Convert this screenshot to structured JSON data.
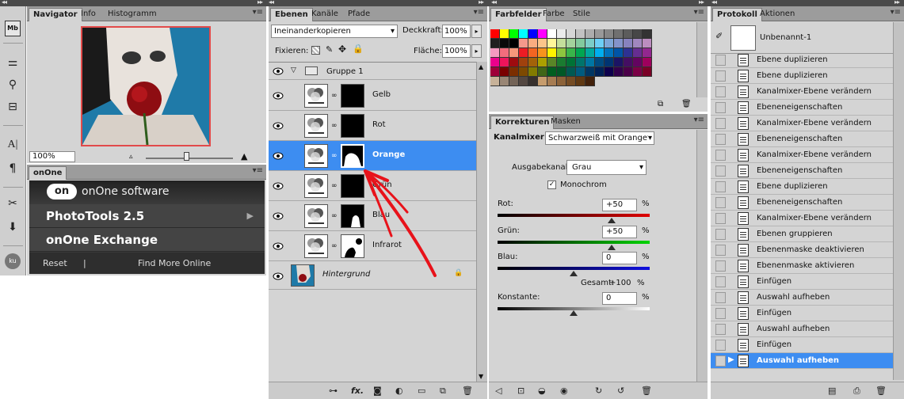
{
  "navigator_panel": {
    "tabs": [
      "Navigator",
      "Info",
      "Histogramm"
    ],
    "zoom": "100%"
  },
  "onone_panel": {
    "tab": "onOne",
    "brand_logo": "on",
    "brand_text": "onOne software",
    "items": [
      "PhotoTools 2.5",
      "onOne Exchange"
    ],
    "footer_reset": "Reset",
    "footer_separator": "|",
    "footer_find": "Find More Online"
  },
  "left_tools": {
    "mb_label": "Mb",
    "ku_label": "ku"
  },
  "layers_panel": {
    "tabs": [
      "Ebenen",
      "Kanäle",
      "Pfade"
    ],
    "blend_mode": "Ineinanderkopieren",
    "opacity_label": "Deckkraft:",
    "opacity_value": "100%",
    "lock_label": "Fixieren:",
    "fill_label": "Fläche:",
    "fill_value": "100%",
    "group_name": "Gruppe 1",
    "layers": [
      {
        "name": "Gelb"
      },
      {
        "name": "Rot"
      },
      {
        "name": "Orange"
      },
      {
        "name": "Grün"
      },
      {
        "name": "Blau"
      },
      {
        "name": "Infrarot"
      }
    ],
    "background_name": "Hintergrund"
  },
  "swatches_panel": {
    "tabs": [
      "Farbfelder",
      "Farbe",
      "Stile"
    ],
    "colors": [
      "#ff0000",
      "#ffff00",
      "#00ff00",
      "#00ffff",
      "#0000ff",
      "#ff00ff",
      "#ffffff",
      "#ebebeb",
      "#d6d6d6",
      "#c2c2c2",
      "#adadad",
      "#999999",
      "#858585",
      "#707070",
      "#5c5c5c",
      "#474747",
      "#333333",
      "#1f1f1f",
      "#0a0a0a",
      "#000000",
      "#f5998c",
      "#f9ad81",
      "#fdc68a",
      "#fff79a",
      "#c4df9b",
      "#a3d39c",
      "#82ca9d",
      "#7bcdc8",
      "#6ecff6",
      "#7ea7d8",
      "#8493ca",
      "#8882be",
      "#a187be",
      "#bc8dbf",
      "#f49ac1",
      "#f26d7d",
      "#f7977a",
      "#ed1c24",
      "#f26522",
      "#f7941d",
      "#fff200",
      "#8dc63f",
      "#39b54a",
      "#00a651",
      "#00a99d",
      "#00aeef",
      "#0072bc",
      "#0054a6",
      "#2e3192",
      "#662d91",
      "#92278f",
      "#ec008c",
      "#ed145b",
      "#9e0b0f",
      "#a0410d",
      "#a36209",
      "#aba000",
      "#598527",
      "#1a7b30",
      "#007236",
      "#00746b",
      "#0076a3",
      "#004b80",
      "#003471",
      "#1b1464",
      "#440e62",
      "#630460",
      "#9e005d",
      "#9e0039",
      "#790000",
      "#7b2e00",
      "#7d4900",
      "#827b00",
      "#406618",
      "#005e20",
      "#005826",
      "#005952",
      "#005b7f",
      "#003663",
      "#002157",
      "#0d004c",
      "#32004b",
      "#4b0049",
      "#7b0046",
      "#7a0026",
      "#c7b299",
      "#998675",
      "#736357",
      "#534741",
      "#37302d",
      "#c69c6d",
      "#a67c52",
      "#8c6239",
      "#754c24",
      "#603913",
      "#42210b"
    ]
  },
  "adjustments_panel": {
    "tabs": [
      "Korrekturen",
      "Masken"
    ],
    "title": "Kanalmixer",
    "preset": "Schwarzweiß mit Orangef",
    "output_label": "Ausgabekanal:",
    "output_value": "Grau",
    "monochrome_label": "Monochrom",
    "sliders": [
      {
        "label": "Rot:",
        "value": "+50",
        "unit": "%",
        "level": 0.75
      },
      {
        "label": "Grün:",
        "value": "+50",
        "unit": "%",
        "level": 0.75
      },
      {
        "label": "Blau:",
        "value": "0",
        "unit": "%",
        "level": 0.5
      }
    ],
    "total_label": "Gesamt:",
    "total_value": "+100",
    "total_unit": "%",
    "constant_label": "Konstante:",
    "constant_value": "0",
    "constant_unit": "%",
    "constant_level": 0.5
  },
  "history_panel": {
    "tabs": [
      "Protokoll",
      "Aktionen"
    ],
    "snapshot": "Unbenannt-1",
    "items": [
      "Ebene duplizieren",
      "Ebene duplizieren",
      "Kanalmixer-Ebene verändern",
      "Ebeneneigenschaften",
      "Kanalmixer-Ebene verändern",
      "Ebeneneigenschaften",
      "Kanalmixer-Ebene verändern",
      "Ebeneneigenschaften",
      "Ebene duplizieren",
      "Ebeneneigenschaften",
      "Kanalmixer-Ebene verändern",
      "Ebenen gruppieren",
      "Ebenenmaske deaktivieren",
      "Ebenenmaske aktivieren",
      "Einfügen",
      "Auswahl aufheben",
      "Einfügen",
      "Auswahl aufheben",
      "Einfügen",
      "Auswahl aufheben"
    ]
  }
}
